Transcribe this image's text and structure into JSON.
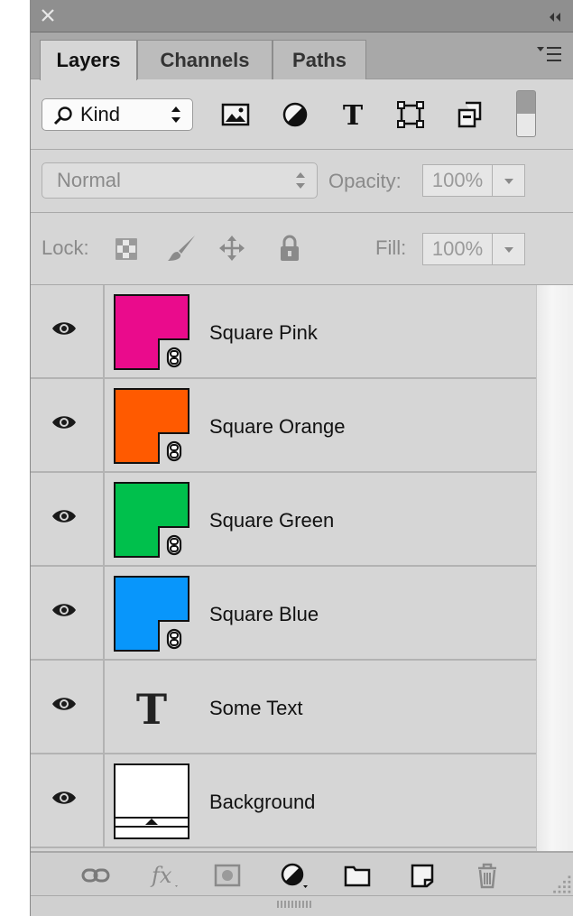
{
  "panel": {
    "tabs": [
      {
        "label": "Layers",
        "active": true
      },
      {
        "label": "Channels",
        "active": false
      },
      {
        "label": "Paths",
        "active": false
      }
    ],
    "icons": {
      "close": "close-icon",
      "collapse": "double-chevron-icon",
      "menu": "panel-menu-icon"
    }
  },
  "filter": {
    "kind_label": "Kind",
    "icons": [
      "pixel-filter-icon",
      "adjustment-filter-icon",
      "type-filter-icon",
      "shape-filter-icon",
      "smart-object-filter-icon"
    ]
  },
  "blend": {
    "mode": "Normal",
    "opacity_label": "Opacity:",
    "opacity_value": "100%"
  },
  "lock": {
    "label": "Lock:",
    "fill_label": "Fill:",
    "fill_value": "100%",
    "icons": [
      "lock-transparent-icon",
      "lock-image-icon",
      "lock-position-icon",
      "lock-all-icon"
    ]
  },
  "layers": [
    {
      "name": "Square Pink",
      "color": "#ea0b8c",
      "kind": "smart"
    },
    {
      "name": "Square Orange",
      "color": "#ff5a00",
      "kind": "smart"
    },
    {
      "name": "Square Green",
      "color": "#00c04c",
      "kind": "smart"
    },
    {
      "name": "Square Blue",
      "color": "#0896fb",
      "kind": "smart"
    },
    {
      "name": "Some Text",
      "color": "#222222",
      "kind": "text"
    },
    {
      "name": "Background",
      "color": "#ffffff",
      "kind": "background"
    }
  ],
  "bottom_icons": [
    "link-icon",
    "fx-icon",
    "mask-icon",
    "adjustment-icon",
    "folder-icon",
    "new-layer-icon",
    "trash-icon"
  ],
  "glyphs": {
    "type_T": "T",
    "fx": "fx"
  }
}
